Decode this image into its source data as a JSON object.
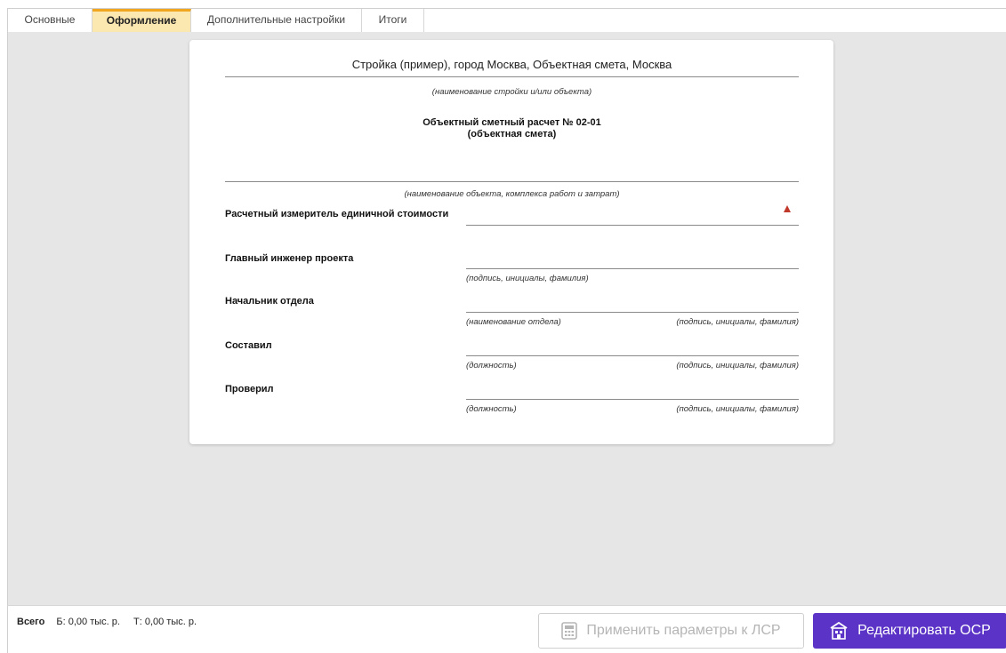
{
  "tabs": [
    {
      "label": "Основные"
    },
    {
      "label": "Оформление"
    },
    {
      "label": "Дополнительные настройки"
    },
    {
      "label": "Итоги"
    }
  ],
  "document": {
    "project_title": "Стройка (пример), город Москва, Объектная смета, Москва",
    "project_hint": "(наименование стройки и/или объекта)",
    "title_line1": "Объектный сметный расчет № 02-01",
    "title_line2": "(объектная смета)",
    "object_hint": "(наименование объекта, комплекса работ и затрат)",
    "unit_cost_label": "Расчетный измеритель единичной стоимости",
    "chief_engineer_label": "Главный инженер проекта",
    "signature_hint": "(подпись, инициалы, фамилия)",
    "department_head_label": "Начальник отдела",
    "department_hint": "(наименование отдела)",
    "compiled_label": "Составил",
    "position_hint": "(должность)",
    "checked_label": "Проверил"
  },
  "footer": {
    "total_label": "Всего",
    "b_total": "Б: 0,00 тыс. р.",
    "t_total": "Т: 0,00 тыс. р.",
    "apply_button": "Применить параметры к ЛСР",
    "edit_button": "Редактировать ОСР"
  },
  "colors": {
    "accent": "#5b33c6",
    "active_tab_bg": "#fbe7b0",
    "active_tab_border": "#f0a61e",
    "warning": "#c0392b"
  },
  "icons": {
    "warning": "warning-icon",
    "apply": "calculator-icon",
    "edit": "building-icon"
  }
}
